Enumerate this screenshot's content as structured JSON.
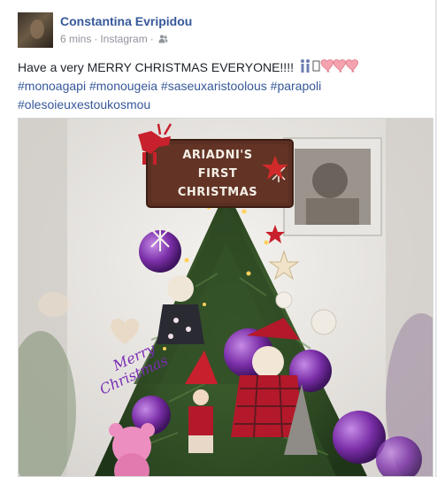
{
  "post": {
    "author": "Constantina Evripidou",
    "time": "6 mins",
    "separator": "·",
    "via": "Instagram",
    "privacy_icon": "friends-icon",
    "text_prefix": "Have a very MERRY CHRISTMAS EVERYONE!!!! ",
    "emoji_icons": [
      "couple-icon",
      "unknown-glyph",
      "heart-icon",
      "heart-icon",
      "heart-icon"
    ],
    "hashtags_line2": [
      "#monoagapi",
      "#monougeia",
      "#saseuxaristoolous",
      "#parapoli"
    ],
    "hashtags_line3": [
      "#olesoieuxestoukosmou"
    ]
  },
  "photo": {
    "sign_line1": "ARIADNI'S",
    "sign_line2": "FIRST",
    "sign_line3": "CHRISTMAS",
    "ornament_text_1": "Merry",
    "ornament_text_2": "Christmas",
    "colors": {
      "sign_wood": "#5a2f22",
      "tree_green": "#2e4a24",
      "ornament_purple": "#7b2fa8",
      "accent_red": "#c8202c"
    }
  }
}
